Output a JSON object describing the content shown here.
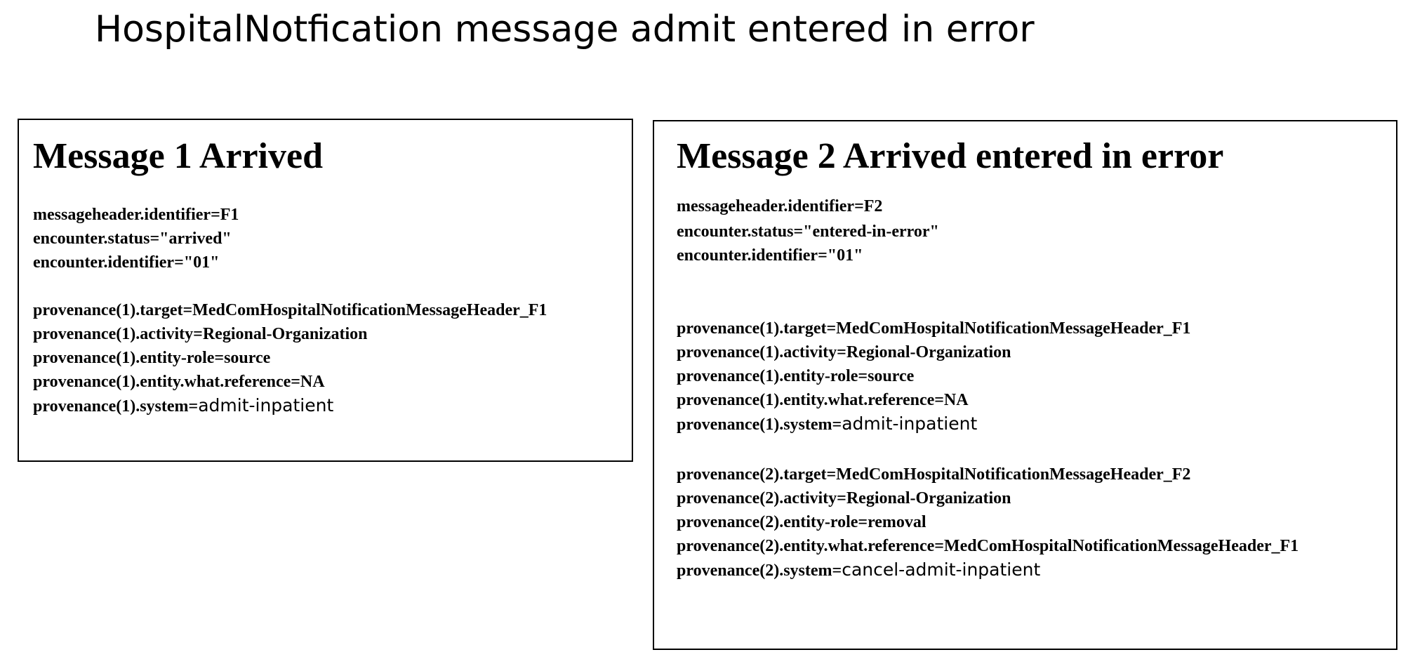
{
  "title": "HospitalNotfication message admit entered in error",
  "message1": {
    "heading": "Message 1 Arrived",
    "header_lines": [
      "messageheader.identifier=F1",
      "encounter.status=\"arrived\"",
      "encounter.identifier=\"01\""
    ],
    "provenance1": {
      "target": "provenance(1).target=MedComHospitalNotificationMessageHeader_F1",
      "activity": "provenance(1).activity=Regional-Organization",
      "entity_role": "provenance(1).entity-role=source",
      "entity_reference": "provenance(1).entity.what.reference=NA",
      "system_key": "provenance(1).system=",
      "system_value": "admit-inpatient"
    }
  },
  "message2": {
    "heading": "Message 2 Arrived entered in error",
    "header_lines": [
      "messageheader.identifier=F2",
      "encounter.status=\"entered-in-error\"",
      "encounter.identifier=\"01\""
    ],
    "provenance1": {
      "target": "provenance(1).target=MedComHospitalNotificationMessageHeader_F1",
      "activity": "provenance(1).activity=Regional-Organization",
      "entity_role": "provenance(1).entity-role=source",
      "entity_reference": "provenance(1).entity.what.reference=NA",
      "system_key": "provenance(1).system=",
      "system_value": "admit-inpatient"
    },
    "provenance2": {
      "target": "provenance(2).target=MedComHospitalNotificationMessageHeader_F2",
      "activity": "provenance(2).activity=Regional-Organization",
      "entity_role": "provenance(2).entity-role=removal",
      "entity_reference": "provenance(2).entity.what.reference=MedComHospitalNotificationMessageHeader_F1",
      "system_key": "provenance(2).system=",
      "system_value": "cancel-admit-inpatient"
    }
  }
}
